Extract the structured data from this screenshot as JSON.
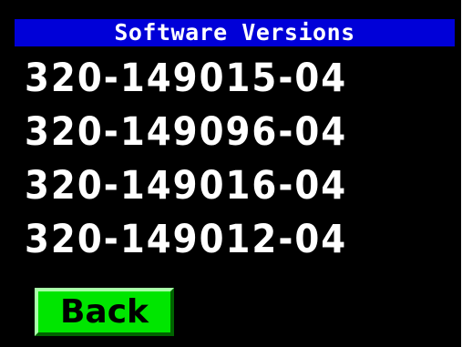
{
  "header": {
    "title": "Software Versions"
  },
  "versions": [
    "320-149015-04",
    "320-149096-04",
    "320-149016-04",
    "320-149012-04"
  ],
  "actions": {
    "back_label": "Back"
  },
  "colors": {
    "background": "#000000",
    "title_bar": "#0000d8",
    "text": "#ffffff",
    "back_button": "#00e600"
  }
}
